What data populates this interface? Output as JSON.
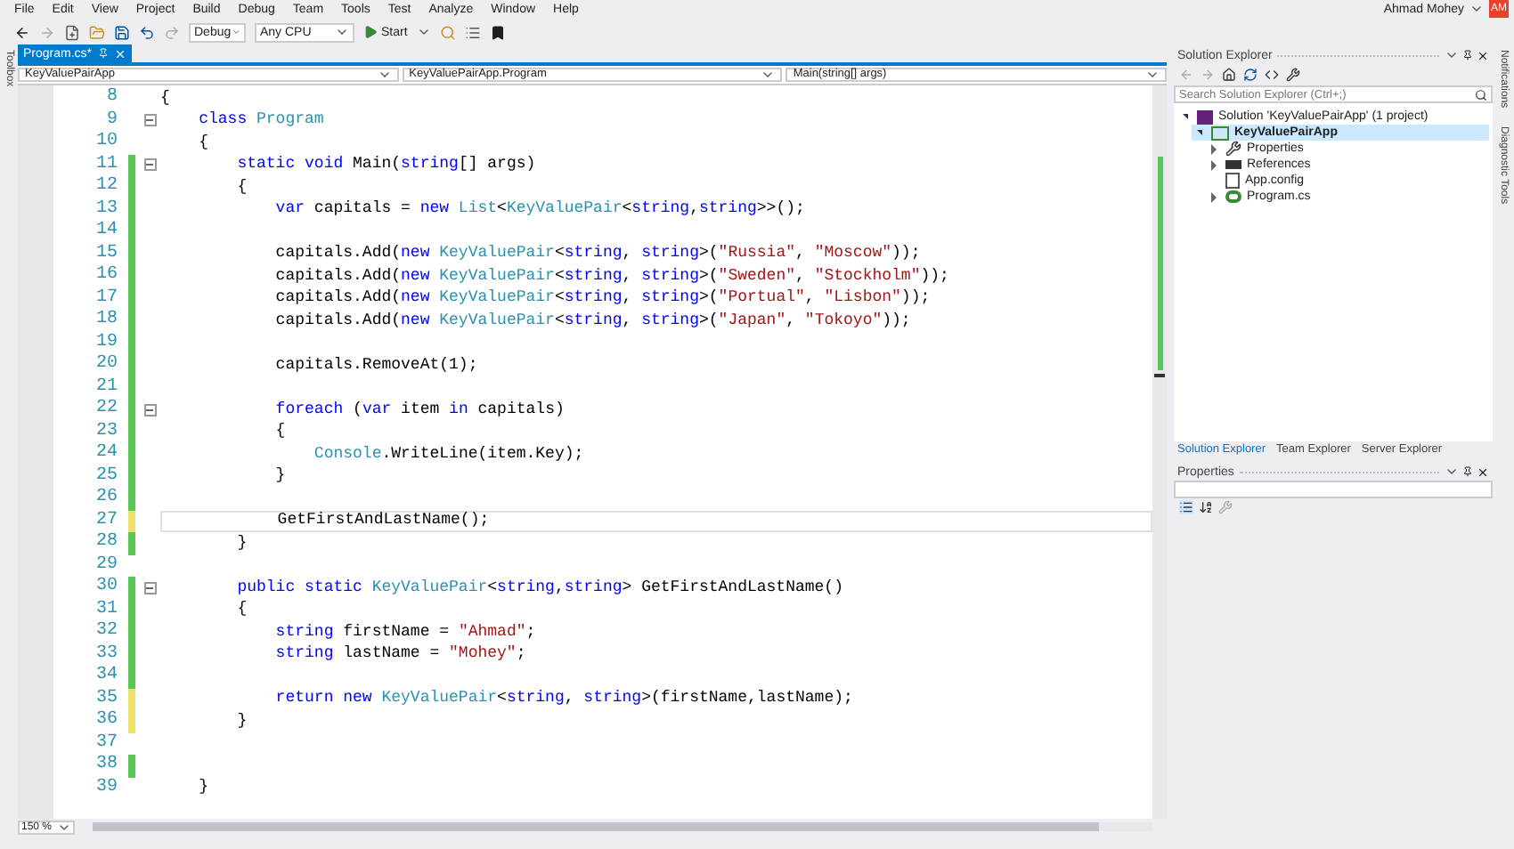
{
  "menu": [
    "File",
    "Edit",
    "View",
    "Project",
    "Build",
    "Debug",
    "Team",
    "Tools",
    "Test",
    "Analyze",
    "Window",
    "Help"
  ],
  "user": {
    "name": "Ahmad Mohey",
    "initials": "AM"
  },
  "toolbar": {
    "configuration": "Debug",
    "platform": "Any CPU",
    "start": "Start"
  },
  "left_strip": "Toolbox",
  "right_strip": [
    "Notifications",
    "Diagnostic Tools"
  ],
  "doc_tabs": [
    {
      "label": "Program.cs*",
      "selected": true
    }
  ],
  "nav_bar": [
    "KeyValuePairApp",
    "KeyValuePairApp.Program",
    "Main(string[] args)"
  ],
  "code_lines": [
    {
      "number": "8",
      "fold": false,
      "current": false,
      "tokens": [
        {
          "kind": "plain",
          "text": "{"
        }
      ]
    },
    {
      "number": "9",
      "fold": true,
      "current": false,
      "tokens": [
        {
          "kind": "keyword",
          "text": "    class"
        },
        {
          "kind": "type",
          "text": " Program"
        }
      ]
    },
    {
      "number": "10",
      "fold": false,
      "current": false,
      "tokens": [
        {
          "kind": "plain",
          "text": "    {"
        }
      ]
    },
    {
      "number": "11",
      "color": "#57c857",
      "fold": true,
      "current": false,
      "tokens": [
        {
          "kind": "keyword",
          "text": "        static void"
        },
        {
          "kind": "plain",
          "text": " Main("
        },
        {
          "kind": "keyword",
          "text": "string"
        },
        {
          "kind": "plain",
          "text": "[] args)"
        }
      ]
    },
    {
      "number": "12",
      "color": "#57c857",
      "fold": false,
      "current": false,
      "tokens": [
        {
          "kind": "plain",
          "text": "        {"
        }
      ]
    },
    {
      "number": "13",
      "color": "#57c857",
      "fold": false,
      "current": false,
      "tokens": [
        {
          "kind": "keyword",
          "text": "            var"
        },
        {
          "kind": "plain",
          "text": " capitals = "
        },
        {
          "kind": "keyword",
          "text": "new"
        },
        {
          "kind": "type",
          "text": " List"
        },
        {
          "kind": "plain",
          "text": "<"
        },
        {
          "kind": "type",
          "text": "KeyValuePair"
        },
        {
          "kind": "plain",
          "text": "<"
        },
        {
          "kind": "keyword",
          "text": "string"
        },
        {
          "kind": "plain",
          "text": ","
        },
        {
          "kind": "keyword",
          "text": "string"
        },
        {
          "kind": "plain",
          "text": ">>();"
        }
      ]
    },
    {
      "number": "14",
      "color": "#57c857",
      "fold": false,
      "current": false
    },
    {
      "number": "15",
      "color": "#57c857",
      "fold": false,
      "current": false,
      "tokens": [
        {
          "kind": "plain",
          "text": "            capitals.Add("
        },
        {
          "kind": "keyword",
          "text": "new"
        },
        {
          "kind": "type",
          "text": " KeyValuePair"
        },
        {
          "kind": "plain",
          "text": "<"
        },
        {
          "kind": "keyword",
          "text": "string"
        },
        {
          "kind": "plain",
          "text": ","
        },
        {
          "kind": "keyword",
          "text": " string"
        },
        {
          "kind": "plain",
          "text": ">("
        },
        {
          "kind": "string",
          "text": "\"Russia\""
        },
        {
          "kind": "plain",
          "text": ","
        },
        {
          "kind": "string",
          "text": " \"Moscow\""
        },
        {
          "kind": "plain",
          "text": "));"
        }
      ]
    },
    {
      "number": "16",
      "color": "#57c857",
      "fold": false,
      "current": false,
      "tokens": [
        {
          "kind": "plain",
          "text": "            capitals.Add("
        },
        {
          "kind": "keyword",
          "text": "new"
        },
        {
          "kind": "type",
          "text": " KeyValuePair"
        },
        {
          "kind": "plain",
          "text": "<"
        },
        {
          "kind": "keyword",
          "text": "string"
        },
        {
          "kind": "plain",
          "text": ","
        },
        {
          "kind": "keyword",
          "text": " string"
        },
        {
          "kind": "plain",
          "text": ">("
        },
        {
          "kind": "string",
          "text": "\"Sweden\""
        },
        {
          "kind": "plain",
          "text": ","
        },
        {
          "kind": "string",
          "text": " \"Stockholm\""
        },
        {
          "kind": "plain",
          "text": "));"
        }
      ]
    },
    {
      "number": "17",
      "color": "#57c857",
      "fold": false,
      "current": false,
      "tokens": [
        {
          "kind": "plain",
          "text": "            capitals.Add("
        },
        {
          "kind": "keyword",
          "text": "new"
        },
        {
          "kind": "type",
          "text": " KeyValuePair"
        },
        {
          "kind": "plain",
          "text": "<"
        },
        {
          "kind": "keyword",
          "text": "string"
        },
        {
          "kind": "plain",
          "text": ","
        },
        {
          "kind": "keyword",
          "text": " string"
        },
        {
          "kind": "plain",
          "text": ">("
        },
        {
          "kind": "string",
          "text": "\"Portual\""
        },
        {
          "kind": "plain",
          "text": ","
        },
        {
          "kind": "string",
          "text": " \"Lisbon\""
        },
        {
          "kind": "plain",
          "text": "));"
        }
      ]
    },
    {
      "number": "18",
      "color": "#57c857",
      "fold": false,
      "current": false,
      "tokens": [
        {
          "kind": "plain",
          "text": "            capitals.Add("
        },
        {
          "kind": "keyword",
          "text": "new"
        },
        {
          "kind": "type",
          "text": " KeyValuePair"
        },
        {
          "kind": "plain",
          "text": "<"
        },
        {
          "kind": "keyword",
          "text": "string"
        },
        {
          "kind": "plain",
          "text": ","
        },
        {
          "kind": "keyword",
          "text": " string"
        },
        {
          "kind": "plain",
          "text": ">("
        },
        {
          "kind": "string",
          "text": "\"Japan\""
        },
        {
          "kind": "plain",
          "text": ","
        },
        {
          "kind": "string",
          "text": " \"Tokoyo\""
        },
        {
          "kind": "plain",
          "text": "));"
        }
      ]
    },
    {
      "number": "19",
      "color": "#57c857",
      "fold": false,
      "current": false
    },
    {
      "number": "20",
      "color": "#57c857",
      "fold": false,
      "current": false,
      "tokens": [
        {
          "kind": "plain",
          "text": "            capitals.RemoveAt(1);"
        }
      ]
    },
    {
      "number": "21",
      "color": "#57c857",
      "fold": false,
      "current": false
    },
    {
      "number": "22",
      "color": "#57c857",
      "fold": true,
      "current": false,
      "tokens": [
        {
          "kind": "keyword",
          "text": "            foreach"
        },
        {
          "kind": "plain",
          "text": " ("
        },
        {
          "kind": "keyword",
          "text": "var"
        },
        {
          "kind": "plain",
          "text": " item "
        },
        {
          "kind": "keyword",
          "text": "in"
        },
        {
          "kind": "plain",
          "text": " capitals)"
        }
      ]
    },
    {
      "number": "23",
      "color": "#57c857",
      "fold": false,
      "current": false,
      "tokens": [
        {
          "kind": "plain",
          "text": "            {"
        }
      ]
    },
    {
      "number": "24",
      "color": "#57c857",
      "fold": false,
      "current": false,
      "tokens": [
        {
          "kind": "type",
          "text": "                Console"
        },
        {
          "kind": "plain",
          "text": ".WriteLine(item.Key);"
        }
      ]
    },
    {
      "number": "25",
      "color": "#57c857",
      "fold": false,
      "current": false,
      "tokens": [
        {
          "kind": "plain",
          "text": "            }"
        }
      ]
    },
    {
      "number": "26",
      "color": "#57c857",
      "fold": false,
      "current": false
    },
    {
      "number": "27",
      "color": "#efe26a",
      "fold": false,
      "current": true,
      "tokens": [
        {
          "kind": "plain",
          "text": "            GetFirstAndLastName();"
        }
      ]
    },
    {
      "number": "28",
      "color": "#57c857",
      "fold": false,
      "current": false,
      "tokens": [
        {
          "kind": "plain",
          "text": "        }"
        }
      ]
    },
    {
      "number": "29",
      "fold": false,
      "current": false
    },
    {
      "number": "30",
      "color": "#57c857",
      "fold": true,
      "current": false,
      "tokens": [
        {
          "kind": "keyword",
          "text": "        public static"
        },
        {
          "kind": "type",
          "text": " KeyValuePair"
        },
        {
          "kind": "plain",
          "text": "<"
        },
        {
          "kind": "keyword",
          "text": "string"
        },
        {
          "kind": "plain",
          "text": ","
        },
        {
          "kind": "keyword",
          "text": "string"
        },
        {
          "kind": "plain",
          "text": "> GetFirstAndLastName()"
        }
      ]
    },
    {
      "number": "31",
      "color": "#57c857",
      "fold": false,
      "current": false,
      "tokens": [
        {
          "kind": "plain",
          "text": "        {"
        }
      ]
    },
    {
      "number": "32",
      "color": "#57c857",
      "fold": false,
      "current": false,
      "tokens": [
        {
          "kind": "keyword",
          "text": "            string"
        },
        {
          "kind": "plain",
          "text": " firstName = "
        },
        {
          "kind": "string",
          "text": "\"Ahmad\""
        },
        {
          "kind": "plain",
          "text": ";"
        }
      ]
    },
    {
      "number": "33",
      "color": "#57c857",
      "fold": false,
      "current": false,
      "tokens": [
        {
          "kind": "keyword",
          "text": "            string"
        },
        {
          "kind": "plain",
          "text": " lastName = "
        },
        {
          "kind": "string",
          "text": "\"Mohey\""
        },
        {
          "kind": "plain",
          "text": ";"
        }
      ]
    },
    {
      "number": "34",
      "color": "#57c857",
      "fold": false,
      "current": false
    },
    {
      "number": "35",
      "color": "#efe26a",
      "fold": false,
      "current": false,
      "tokens": [
        {
          "kind": "keyword",
          "text": "            return new"
        },
        {
          "kind": "type",
          "text": " KeyValuePair"
        },
        {
          "kind": "plain",
          "text": "<"
        },
        {
          "kind": "keyword",
          "text": "string"
        },
        {
          "kind": "plain",
          "text": ","
        },
        {
          "kind": "keyword",
          "text": " string"
        },
        {
          "kind": "plain",
          "text": ">(firstName,lastName);"
        }
      ]
    },
    {
      "number": "36",
      "color": "#efe26a",
      "fold": false,
      "current": false,
      "tokens": [
        {
          "kind": "plain",
          "text": "        }"
        }
      ]
    },
    {
      "number": "37",
      "fold": false,
      "current": false
    },
    {
      "number": "38",
      "color": "#57c857",
      "fold": false,
      "current": false
    },
    {
      "number": "39",
      "fold": false,
      "current": false,
      "tokens": [
        {
          "kind": "plain",
          "text": "    }"
        }
      ]
    }
  ],
  "zoom": "150 %",
  "solution_explorer": {
    "title": "Solution Explorer",
    "search": {
      "placeholder": "Search Solution Explorer (Ctrl+;)"
    },
    "tree": [
      {
        "label": "Solution 'KeyValuePairApp' (1 project)",
        "kind": "solution",
        "expanded": true,
        "selected": false,
        "children": [
          {
            "label": "KeyValuePairApp",
            "kind": "project",
            "expanded": true,
            "selected": true,
            "children": [
              {
                "label": "Properties",
                "kind": "wrench",
                "expanded": false,
                "selected": false
              },
              {
                "label": "References",
                "kind": "references",
                "expanded": false,
                "selected": false
              },
              {
                "label": "App.config",
                "kind": "config",
                "selected": false
              },
              {
                "label": "Program.cs",
                "kind": "csharp",
                "expanded": false,
                "selected": false
              }
            ]
          }
        ]
      }
    ],
    "tabs": [
      {
        "label": "Solution Explorer",
        "selected": true
      },
      {
        "label": "Team Explorer",
        "selected": false
      },
      {
        "label": "Server Explorer",
        "selected": false
      }
    ]
  },
  "properties": {
    "title": "Properties"
  }
}
